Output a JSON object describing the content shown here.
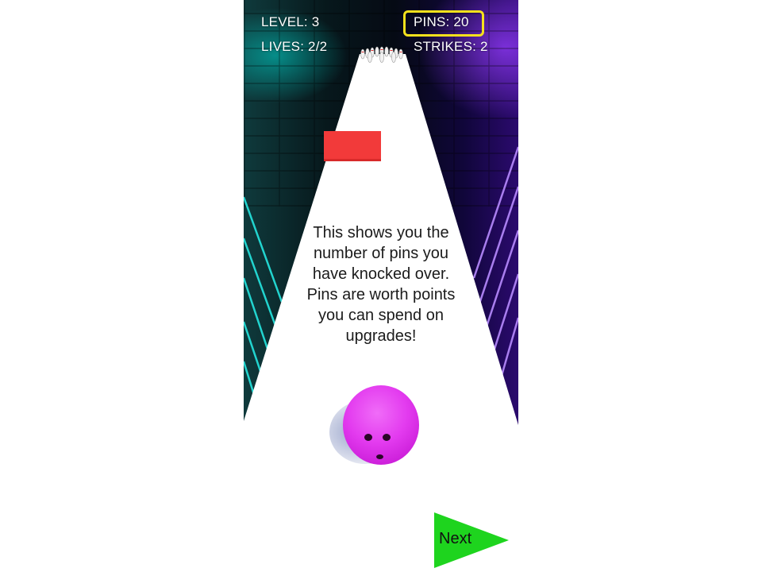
{
  "hud": {
    "level": "LEVEL: 3",
    "lives": "LIVES: 2/2",
    "pins": "PINS: 20",
    "strikes": "STRIKES: 2"
  },
  "tutorial": {
    "message": "This shows you the number of pins you have knocked over. Pins are worth points you can spend on upgrades!"
  },
  "next_button": {
    "label": "Next"
  },
  "colors": {
    "highlight": "#f5e11c",
    "ball": "#e33bef",
    "obstacle": "#f23a3a",
    "next_button": "#1ed41e"
  }
}
